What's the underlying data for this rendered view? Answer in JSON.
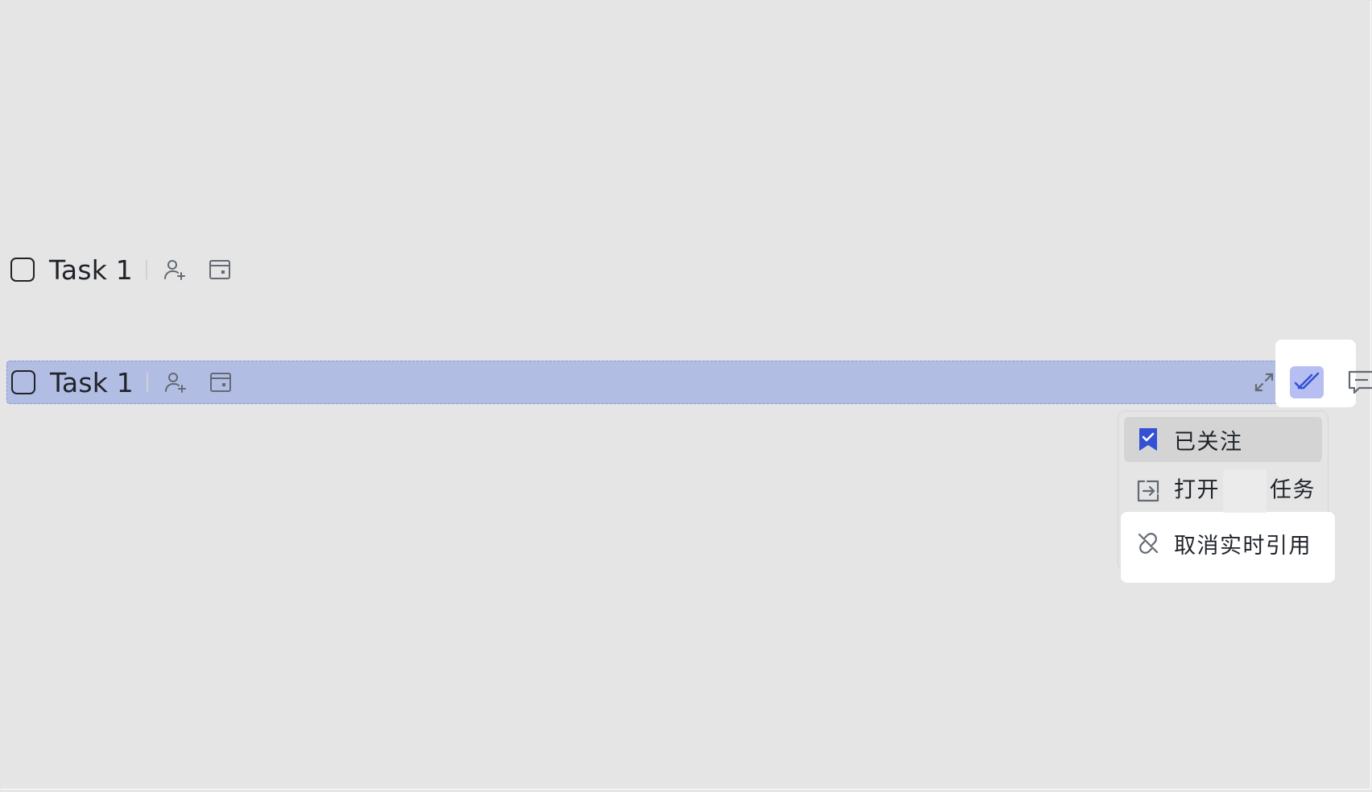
{
  "tasks": [
    {
      "title": "Task 1",
      "completed": false,
      "selected": false
    },
    {
      "title": "Task 1",
      "completed": false,
      "selected": true
    }
  ],
  "toolbar": {
    "icons": [
      "expand-icon",
      "track-task-icon",
      "comment-icon"
    ]
  },
  "context_menu": {
    "items": [
      {
        "label": "已关注",
        "icon": "bookmark-check-icon",
        "active": true
      },
      {
        "label_before": "打开",
        "label_after": "任务",
        "icon": "open-in-icon"
      },
      {
        "label": "取消实时引用",
        "icon": "unlink-icon"
      }
    ]
  },
  "colors": {
    "background": "#e5e5e5",
    "selection": "#b2bde3",
    "accent": "#3451d6",
    "track_button": "#b7bff2",
    "icon_gray": "#646a73"
  }
}
